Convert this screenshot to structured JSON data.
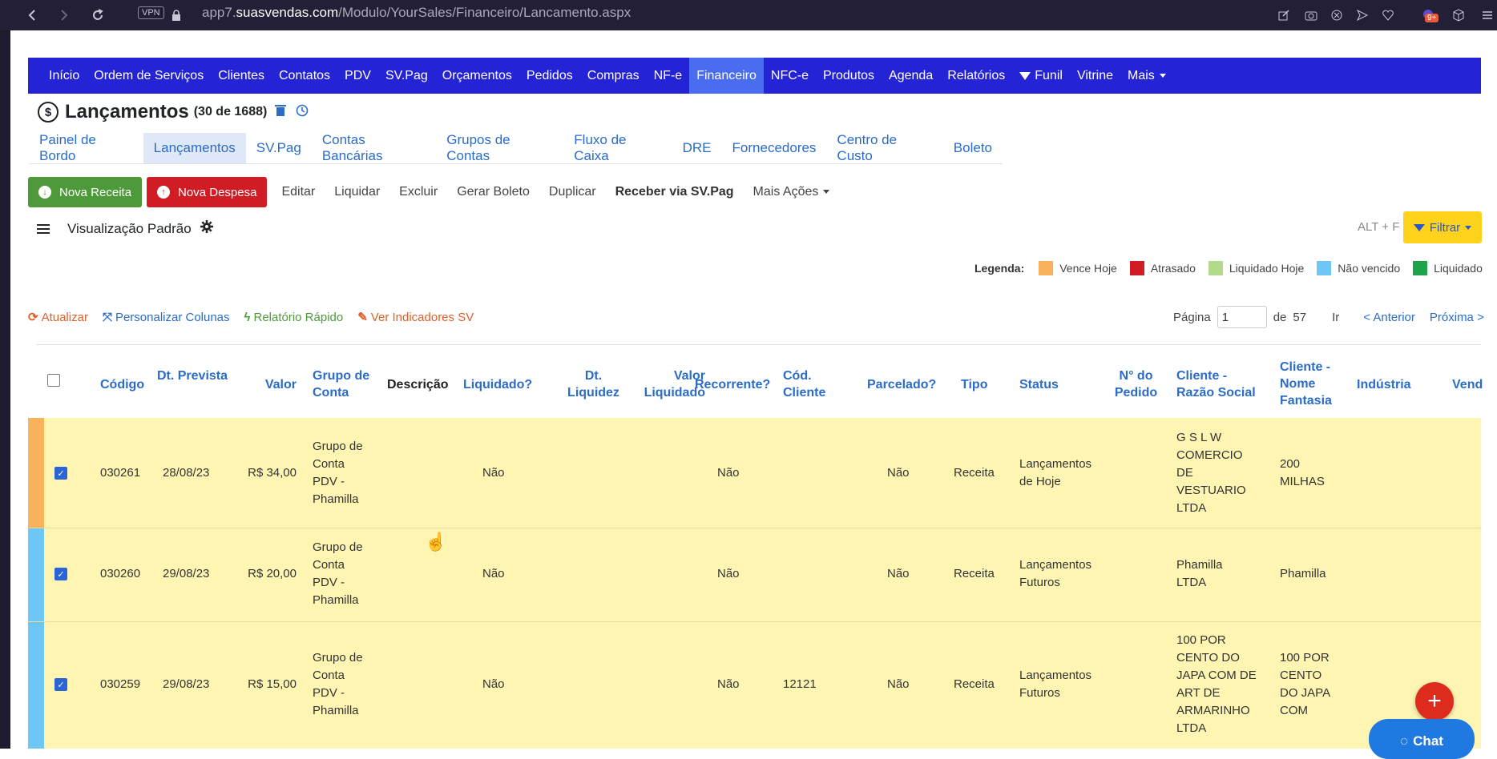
{
  "browser": {
    "url_prefix": "app7.",
    "url_host": "suasvendas.com",
    "url_path": "/Modulo/YourSales/Financeiro/Lancamento.aspx",
    "vpn_label": "VPN",
    "notification_badge": "9+"
  },
  "nav": {
    "items": [
      "Início",
      "Ordem de Serviços",
      "Clientes",
      "Contatos",
      "PDV",
      "SV.Pag",
      "Orçamentos",
      "Pedidos",
      "Compras",
      "NF-e",
      "Financeiro",
      "NFC-e",
      "Produtos",
      "Agenda",
      "Relatórios",
      "Funil",
      "Vitrine",
      "Mais"
    ],
    "active": "Financeiro"
  },
  "page": {
    "title": "Lançamentos",
    "count": "(30 de 1688)"
  },
  "subtabs": {
    "items": [
      "Painel de Bordo",
      "Lançamentos",
      "SV.Pag",
      "Contas Bancárias",
      "Grupos de Contas",
      "Fluxo de Caixa",
      "DRE",
      "Fornecedores",
      "Centro de Custo",
      "Boleto"
    ],
    "active": "Lançamentos"
  },
  "actions": {
    "nova_receita": "Nova Receita",
    "nova_despesa": "Nova Despesa",
    "editar": "Editar",
    "liquidar": "Liquidar",
    "excluir": "Excluir",
    "gerar_boleto": "Gerar Boleto",
    "duplicar": "Duplicar",
    "receber_svpag": "Receber via SV.Pag",
    "mais_acoes": "Mais Ações"
  },
  "view": {
    "name": "Visualização Padrão",
    "shortcut": "ALT + F",
    "filter_label": "Filtrar"
  },
  "legend": {
    "label": "Legenda:",
    "items": [
      {
        "label": "Vence Hoje",
        "color": "#f8b25c"
      },
      {
        "label": "Atrasado",
        "color": "#d11c25"
      },
      {
        "label": "Liquidado Hoje",
        "color": "#b4d98a"
      },
      {
        "label": "Não vencido",
        "color": "#6cc7f5"
      },
      {
        "label": "Liquidado",
        "color": "#1fa34a"
      }
    ]
  },
  "tools": {
    "atualizar": "Atualizar",
    "personalizar": "Personalizar Colunas",
    "relatorio": "Relatório Rápido",
    "indicadores": "Ver Indicadores SV"
  },
  "pager": {
    "label": "Página",
    "current": "1",
    "of": "de",
    "total": "57",
    "go": "Ir",
    "prev": "< Anterior",
    "next": "Próxima >"
  },
  "table": {
    "headers": {
      "codigo": "Código",
      "dt_prevista": "Dt. Prevista",
      "valor": "Valor",
      "grupo_conta": "Grupo de Conta",
      "descricao": "Descrição",
      "liquidado": "Liquidado?",
      "dt_liquidez": "Dt. Liquidez",
      "valor_liquidado": "Valor Liquidado",
      "recorrente": "Recorrente?",
      "cod_cliente": "Cód. Cliente",
      "parcelado": "Parcelado?",
      "tipo": "Tipo",
      "status": "Status",
      "n_pedido": "N° do Pedido",
      "razao_social": "Cliente - Razão Social",
      "nome_fantasia": "Cliente - Nome Fantasia",
      "industria": "Indústria",
      "vendedor": "Vend"
    },
    "rows": [
      {
        "codigo": "030261",
        "dt_prevista": "28/08/23",
        "valor": "R$ 34,00",
        "grupo": "Grupo de Conta PDV - Phamilla",
        "liquidado": "Não",
        "recorrente": "Não",
        "cod_cliente": "",
        "parcelado": "Não",
        "tipo": "Receita",
        "status": "Lançamentos de Hoje",
        "razao_social": "G S L W COMERCIO DE VESTUARIO LTDA",
        "nome_fantasia": "200 MILHAS",
        "bar_color": "#f8b25c"
      },
      {
        "codigo": "030260",
        "dt_prevista": "29/08/23",
        "valor": "R$ 20,00",
        "grupo": "Grupo de Conta PDV - Phamilla",
        "liquidado": "Não",
        "recorrente": "Não",
        "cod_cliente": "",
        "parcelado": "Não",
        "tipo": "Receita",
        "status": "Lançamentos Futuros",
        "razao_social": "Phamilla LTDA",
        "nome_fantasia": "Phamilla",
        "bar_color": "#6cc7f5"
      },
      {
        "codigo": "030259",
        "dt_prevista": "29/08/23",
        "valor": "R$ 15,00",
        "grupo": "Grupo de Conta PDV - Phamilla",
        "liquidado": "Não",
        "recorrente": "Não",
        "cod_cliente": "12121",
        "parcelado": "Não",
        "tipo": "Receita",
        "status": "Lançamentos Futuros",
        "razao_social": "100 POR CENTO DO JAPA COM DE ART DE ARMARINHO LTDA",
        "nome_fantasia": "100 POR CENTO DO JAPA COM",
        "bar_color": "#6cc7f5"
      }
    ]
  },
  "chat": {
    "label": "Chat"
  }
}
